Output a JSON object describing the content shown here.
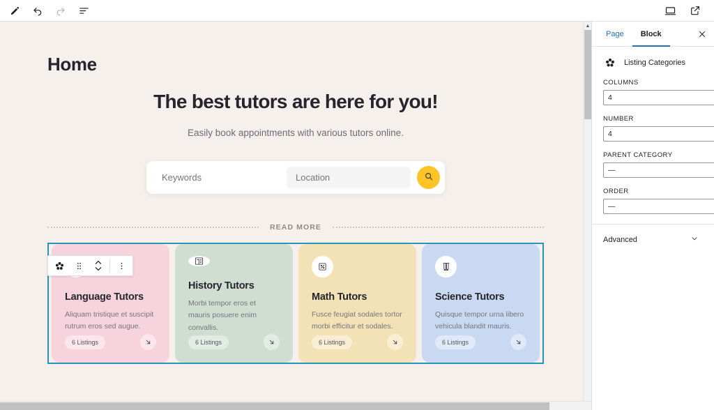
{
  "topbar": {
    "left_tools": [
      {
        "name": "edit-pencil-icon",
        "label": "Edit"
      },
      {
        "name": "undo-icon",
        "label": "Undo"
      },
      {
        "name": "redo-icon",
        "label": "Redo"
      },
      {
        "name": "list-view-icon",
        "label": "Document Overview"
      }
    ],
    "right_tools": [
      {
        "name": "desktop-preview-icon",
        "label": "View"
      },
      {
        "name": "external-link-icon",
        "label": "View site"
      }
    ]
  },
  "canvas": {
    "page_title": "Home",
    "hero": {
      "heading": "The best tutors are here for you!",
      "subheading": "Easily book appointments with various tutors online."
    },
    "search": {
      "keywords_placeholder": "Keywords",
      "keywords_value": "",
      "location_placeholder": "Location",
      "location_value": "",
      "geo_icon": "navigation-arrow-icon",
      "submit_icon": "search-icon",
      "submit_color": "#fcc427"
    },
    "divider": {
      "label": "READ MORE"
    },
    "block_toolbar": {
      "items": [
        {
          "name": "block-type-listing-categories-icon",
          "label": "Listing Categories"
        },
        {
          "name": "drag-handle-icon",
          "label": "Drag"
        },
        {
          "name": "move-up-down-icon",
          "label": "Move up or down"
        },
        {
          "name": "more-options-icon",
          "label": "Options"
        }
      ]
    },
    "cards": [
      {
        "title": "Language Tutors",
        "description": "Aliquam tristique et suscipit rutrum eros sed augue.",
        "listings": "6 Listings",
        "bg": "#f7d4dd",
        "icon": "translate-icon"
      },
      {
        "title": "History Tutors",
        "description": "Morbi tempor eros et mauris posuere enim convallis.",
        "listings": "6 Listings",
        "bg": "#cfded1",
        "icon": "bank-building-icon"
      },
      {
        "title": "Math Tutors",
        "description": "Fusce feugiat sodales tortor morbi efficitur et sodales.",
        "listings": "6 Listings",
        "bg": "#f2e2b5",
        "icon": "percent-calculator-icon"
      },
      {
        "title": "Science Tutors",
        "description": "Quisque tempor urna libero vehicula blandit mauris.",
        "listings": "6 Listings",
        "bg": "#c9d9f2",
        "icon": "test-tubes-icon"
      }
    ],
    "selection_border_color": "#2b93b8",
    "background": "#f5f0ec"
  },
  "sidebar": {
    "tabs": [
      {
        "label": "Page",
        "active": false
      },
      {
        "label": "Block",
        "active": true
      }
    ],
    "close_label": "Close settings",
    "block": {
      "icon": "listing-categories-icon",
      "name": "Listing Categories"
    },
    "fields": [
      {
        "label": "COLUMNS",
        "value": "4",
        "type": "select"
      },
      {
        "label": "NUMBER",
        "value": "4",
        "type": "number"
      },
      {
        "label": "PARENT CATEGORY",
        "value": "—",
        "type": "select"
      },
      {
        "label": "ORDER",
        "value": "—",
        "type": "select"
      }
    ],
    "panels": [
      {
        "label": "Advanced",
        "expanded": false
      }
    ]
  }
}
